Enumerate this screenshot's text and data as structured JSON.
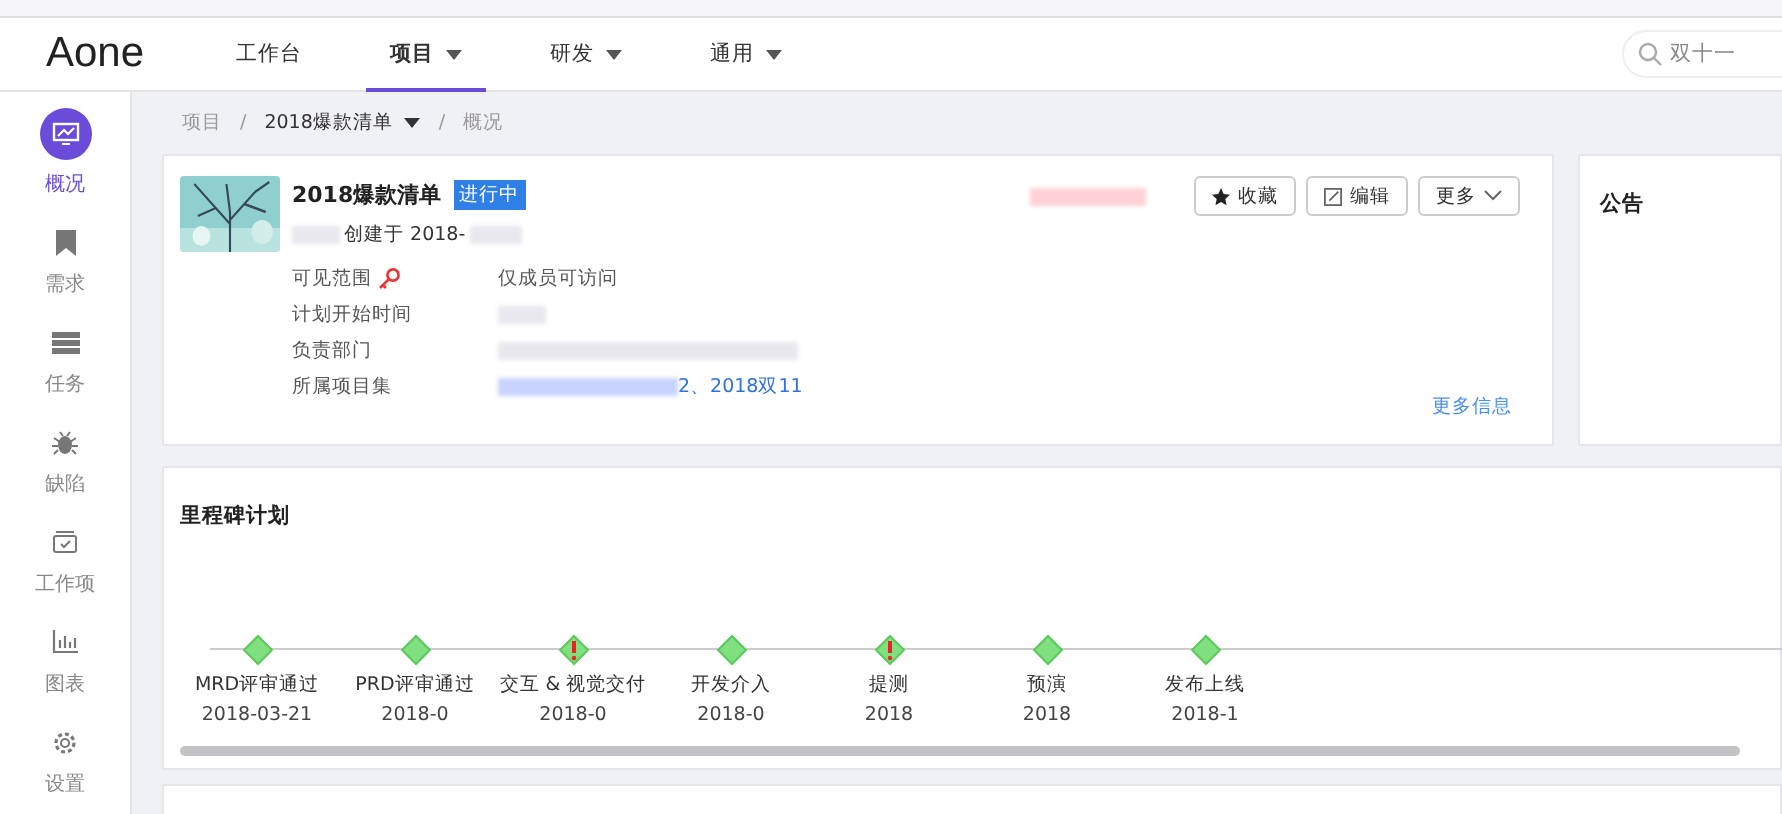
{
  "logo": "Aone",
  "nav": [
    {
      "label": "工作台",
      "dropdown": false,
      "selected": false
    },
    {
      "label": "项目",
      "dropdown": true,
      "selected": true
    },
    {
      "label": "研发",
      "dropdown": true,
      "selected": false
    },
    {
      "label": "通用",
      "dropdown": true,
      "selected": false
    }
  ],
  "search": {
    "placeholder": "双十一"
  },
  "sidebar": [
    {
      "label": "概况",
      "selected": true
    },
    {
      "label": "需求",
      "selected": false
    },
    {
      "label": "任务",
      "selected": false
    },
    {
      "label": "缺陷",
      "selected": false
    },
    {
      "label": "工作项",
      "selected": false
    },
    {
      "label": "图表",
      "selected": false
    },
    {
      "label": "设置",
      "selected": false
    }
  ],
  "breadcrumb": {
    "separator": "/",
    "items": [
      {
        "label": "项目",
        "current": false,
        "dropdown": false
      },
      {
        "label": "2018爆款清单",
        "current": true,
        "dropdown": true
      },
      {
        "label": "概况",
        "current": false,
        "dropdown": false
      }
    ]
  },
  "project": {
    "kind": "picture",
    "title": "2018爆款清单",
    "status": "进行中",
    "created": "创建于 2018-",
    "actions": [
      {
        "label": "收藏"
      },
      {
        "label": "编辑"
      },
      {
        "label": "更多"
      }
    ],
    "fields": [
      {
        "label": "可见范围",
        "value": "仅成员可访问",
        "link": false
      },
      {
        "label": "计划开始时间",
        "link": false
      },
      {
        "label": "负责部门",
        "link": false
      },
      {
        "label": "所属项目集",
        "value": "2、2018双11",
        "link": true
      }
    ],
    "more_link": "更多信息"
  },
  "announcement": {
    "title": "公告"
  },
  "milestones": {
    "title": "里程碑计划",
    "items": [
      {
        "name": "MRD评审通过",
        "date": "2018-03-21",
        "warning": false
      },
      {
        "name": "PRD评审通过",
        "date": "2018-0",
        "warning": false
      },
      {
        "name": "交互 & 视觉交付",
        "date": "2018-0",
        "warning": true
      },
      {
        "name": "开发介入",
        "date": "2018-0",
        "warning": false
      },
      {
        "name": "提测",
        "date": "2018",
        "warning": true
      },
      {
        "name": "预演",
        "date": "2018",
        "warning": false
      },
      {
        "name": "发布上线",
        "date": "2018-1",
        "warning": false
      }
    ]
  }
}
